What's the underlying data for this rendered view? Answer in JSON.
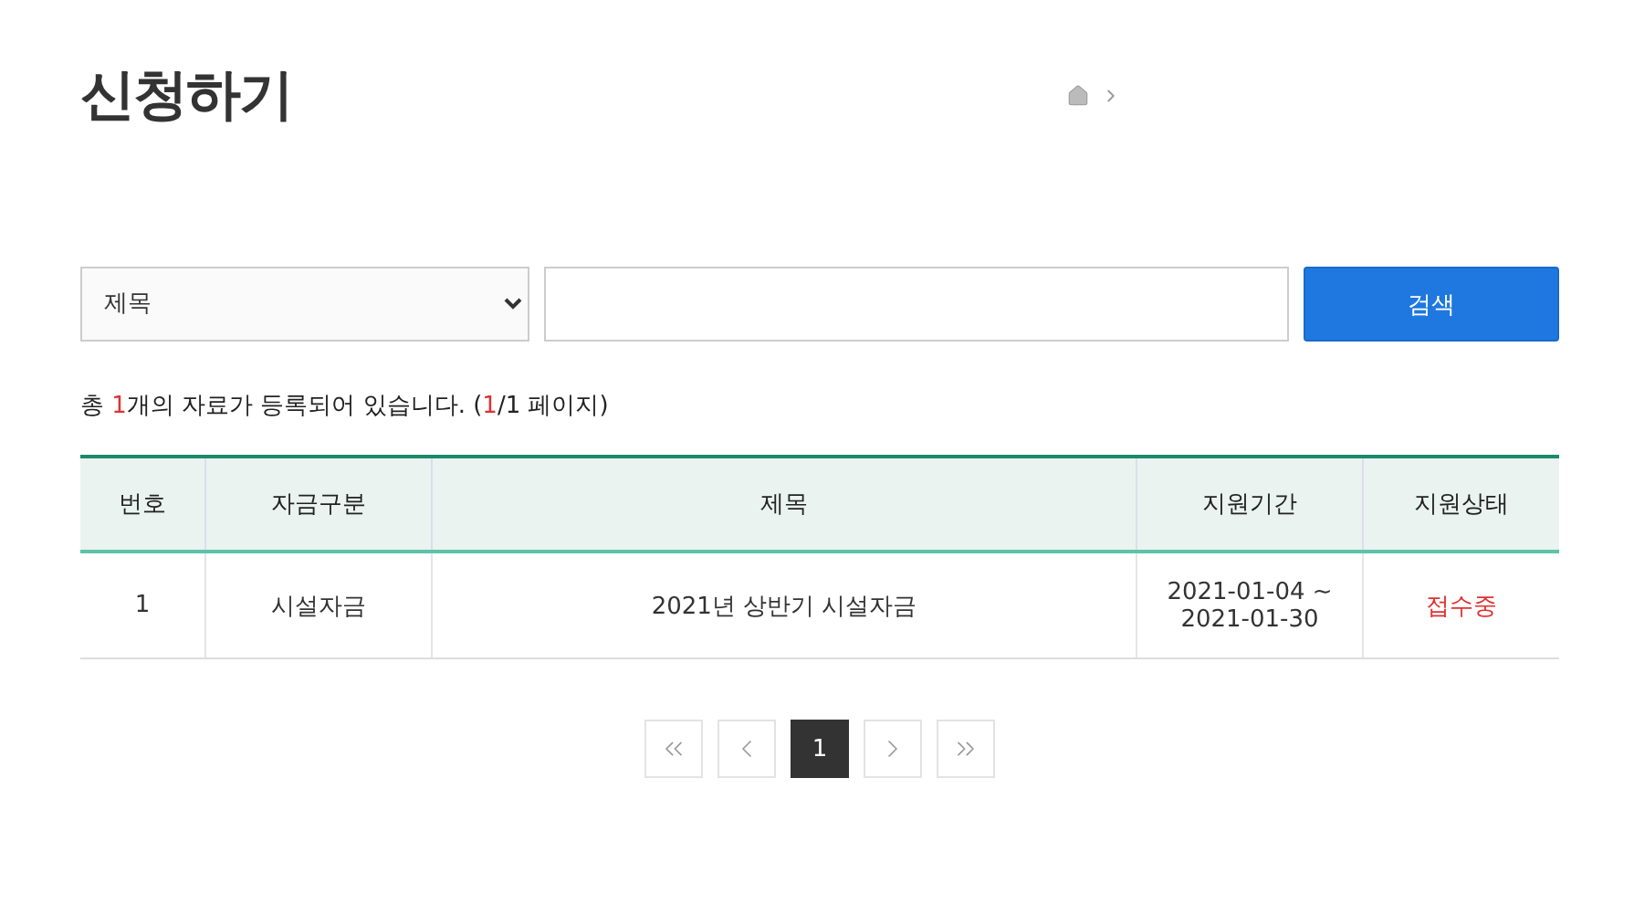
{
  "page_title": "신청하기",
  "breadcrumb": {
    "home": true
  },
  "search": {
    "select_value": "제목",
    "button": "검색"
  },
  "count_text": [
    {
      "text": "총 ",
      "highlight": false
    },
    {
      "text": "1",
      "highlight": true
    },
    {
      "text": "개의 자료가 등록되어 있습니다. (",
      "highlight": false
    },
    {
      "text": "1",
      "highlight": true
    },
    {
      "text": "/1 페이지)",
      "highlight": false
    }
  ],
  "table": {
    "columns": [
      {
        "label": "번호",
        "kind": "number"
      },
      {
        "label": "자금구분",
        "kind": "category"
      },
      {
        "label": "제목",
        "kind": "title"
      },
      {
        "label": "지원기간",
        "kind": "period"
      },
      {
        "label": "지원상태",
        "kind": "status"
      }
    ],
    "rows": [
      {
        "cells": [
          "1",
          "시설자금",
          "2021년 상반기 시설자금",
          "2021-01-04 ~ 2021-01-30",
          "접수중"
        ]
      }
    ]
  },
  "pagination": [
    {
      "kind": "first",
      "selected": false
    },
    {
      "kind": "prev",
      "selected": false
    },
    {
      "kind": "page",
      "label": "1",
      "selected": true
    },
    {
      "kind": "next",
      "selected": false
    },
    {
      "kind": "last",
      "selected": false
    }
  ]
}
